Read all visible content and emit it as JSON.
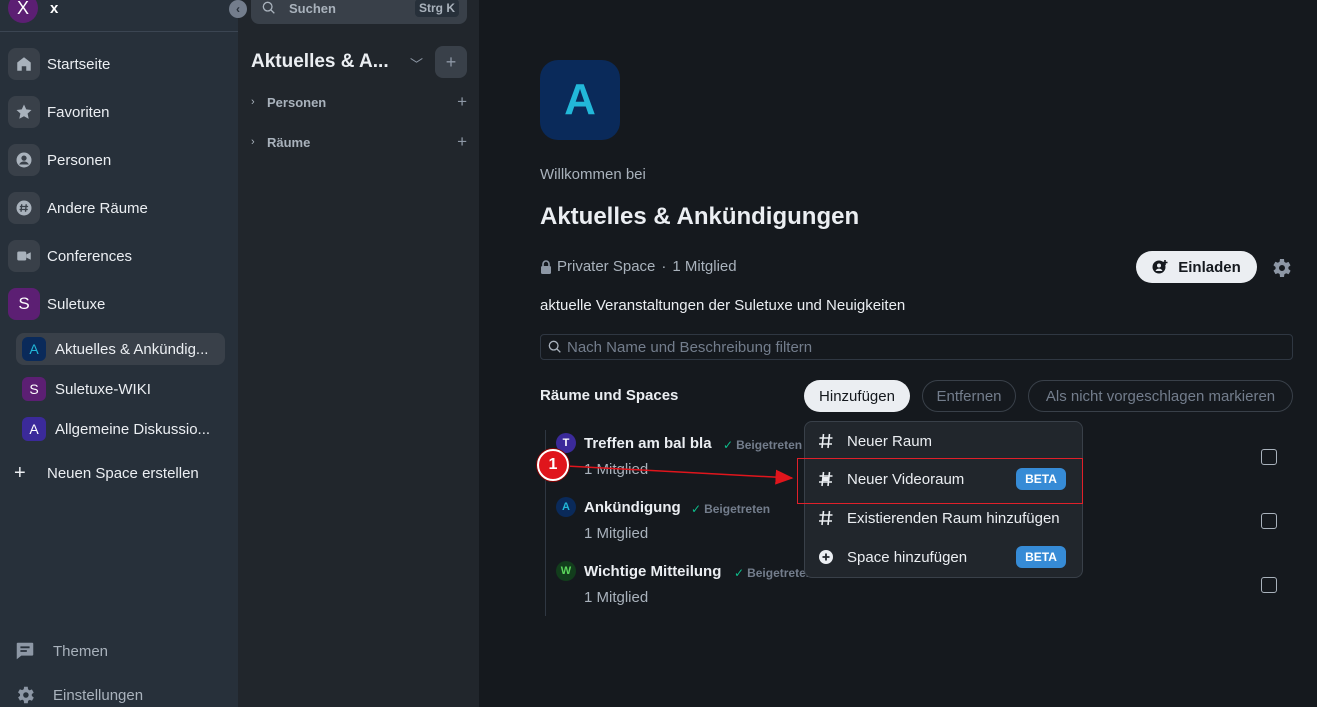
{
  "user": {
    "initial": "X",
    "name": "x"
  },
  "search": {
    "placeholder": "Suchen",
    "shortcut": "Strg K"
  },
  "space_nav": {
    "items": [
      {
        "label": "Startseite",
        "icon": "home-icon"
      },
      {
        "label": "Favoriten",
        "icon": "star-icon"
      },
      {
        "label": "Personen",
        "icon": "person-icon"
      },
      {
        "label": "Andere Räume",
        "icon": "hash-icon"
      },
      {
        "label": "Conferences",
        "icon": "video-icon"
      },
      {
        "label": "Suletuxe",
        "initial": "S"
      }
    ],
    "sub_items": [
      {
        "label": "Aktuelles & Ankündig...",
        "initial": "A",
        "color": "#22b8d9",
        "bg": "#0a2a5a"
      },
      {
        "label": "Suletuxe-WIKI",
        "initial": "S",
        "color": "#ffffff",
        "bg": "#5c1f73"
      },
      {
        "label": "Allgemeine Diskussio...",
        "initial": "A",
        "color": "#ffffff",
        "bg": "#3b2a9a"
      }
    ],
    "create_label": "Neuen Space erstellen",
    "bottom": [
      {
        "label": "Themen",
        "icon": "chat-icon"
      },
      {
        "label": "Einstellungen",
        "icon": "gear-icon"
      }
    ]
  },
  "room_panel": {
    "title": "Aktuelles & A...",
    "sections": [
      {
        "label": "Personen"
      },
      {
        "label": "Räume"
      }
    ]
  },
  "main": {
    "space_initial": "A",
    "welcome": "Willkommen bei",
    "title": "Aktuelles & Ankündigungen",
    "privacy": "Privater Space",
    "separator": "·",
    "members": "1 Mitglied",
    "invite_label": "Einladen",
    "description": "aktuelle Veranstaltungen der Suletuxe und Neuigkeiten",
    "filter_placeholder": "Nach Name und Beschreibung filtern",
    "rooms_heading": "Räume und Spaces",
    "add_label": "Hinzufügen",
    "remove_label": "Entfernen",
    "not_suggested_label": "Als nicht vorgeschlagen markieren",
    "rooms": [
      {
        "initial": "T",
        "name": "Treffen am bal bla",
        "status": "Beigetreten",
        "members": "1 Mitglied",
        "avatar_bg": "#3b2a9a",
        "avatar_color": "#ffffff"
      },
      {
        "initial": "A",
        "name": "Ankündigung",
        "status": "Beigetreten",
        "members": "1 Mitglied",
        "avatar_bg": "#0a2a5a",
        "avatar_color": "#22b8d9"
      },
      {
        "initial": "W",
        "name": "Wichtige Mitteilung",
        "status": "Beigetreten",
        "members": "1 Mitglied",
        "avatar_bg": "#123d1c",
        "avatar_color": "#5cd65c"
      }
    ]
  },
  "dropdown": {
    "items": [
      {
        "label": "Neuer Raum",
        "icon": "hash-icon",
        "badge": ""
      },
      {
        "label": "Neuer Videoraum",
        "icon": "video-hash-icon",
        "badge": "BETA"
      },
      {
        "label": "Existierenden Raum hinzufügen",
        "icon": "hash-icon",
        "badge": ""
      },
      {
        "label": "Space hinzufügen",
        "icon": "plus-circle-icon",
        "badge": "BETA"
      }
    ]
  },
  "annotation": {
    "callout_number": "1",
    "color": "#e0151c"
  }
}
